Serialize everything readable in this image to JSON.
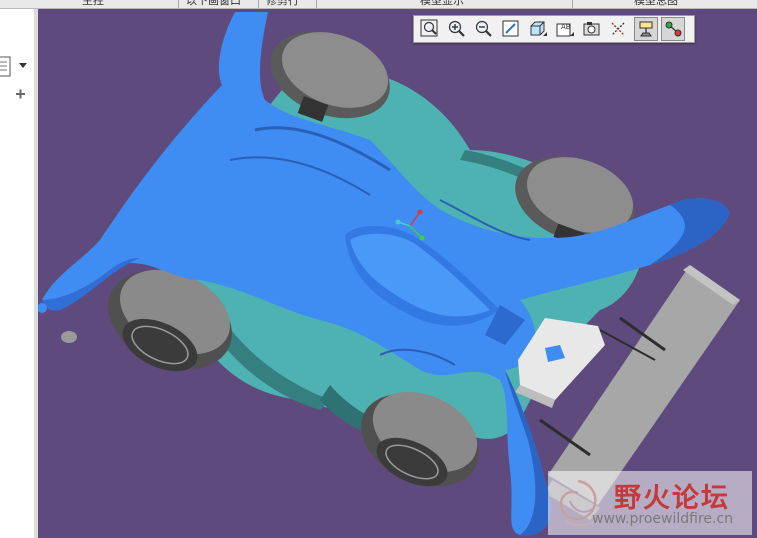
{
  "top_menu": {
    "items": [
      "主控",
      "以下画窗口",
      "修剪行",
      "模型显示",
      "模型总图"
    ]
  },
  "left_panel": {
    "icons": [
      "document-icon",
      "dropdown-arrow-icon",
      "plus-icon"
    ]
  },
  "view_toolbar": {
    "buttons": [
      {
        "name": "refit-zoom-icon",
        "pressed": false
      },
      {
        "name": "zoom-in-icon",
        "pressed": false
      },
      {
        "name": "zoom-out-icon",
        "pressed": false
      },
      {
        "name": "repaint-icon",
        "pressed": false
      },
      {
        "name": "display-style-icon",
        "pressed": false
      },
      {
        "name": "saved-views-icon",
        "pressed": false
      },
      {
        "name": "view-manager-icon",
        "pressed": false
      },
      {
        "name": "datum-axes-icon",
        "pressed": false
      },
      {
        "name": "datum-planes-icon",
        "pressed": true
      },
      {
        "name": "coordinate-systems-icon",
        "pressed": true
      }
    ]
  },
  "model": {
    "description_colors": {
      "body": "#3f8cf3",
      "body_shadow": "#2f6fd6",
      "chassis": "#4fb2b2",
      "tire": "#8c8c8c",
      "rear_wing": "#a9a9a9",
      "background": "#5e4a7c"
    }
  },
  "watermark": {
    "title": "野火论坛",
    "url": "www.proewildfire.cn"
  }
}
